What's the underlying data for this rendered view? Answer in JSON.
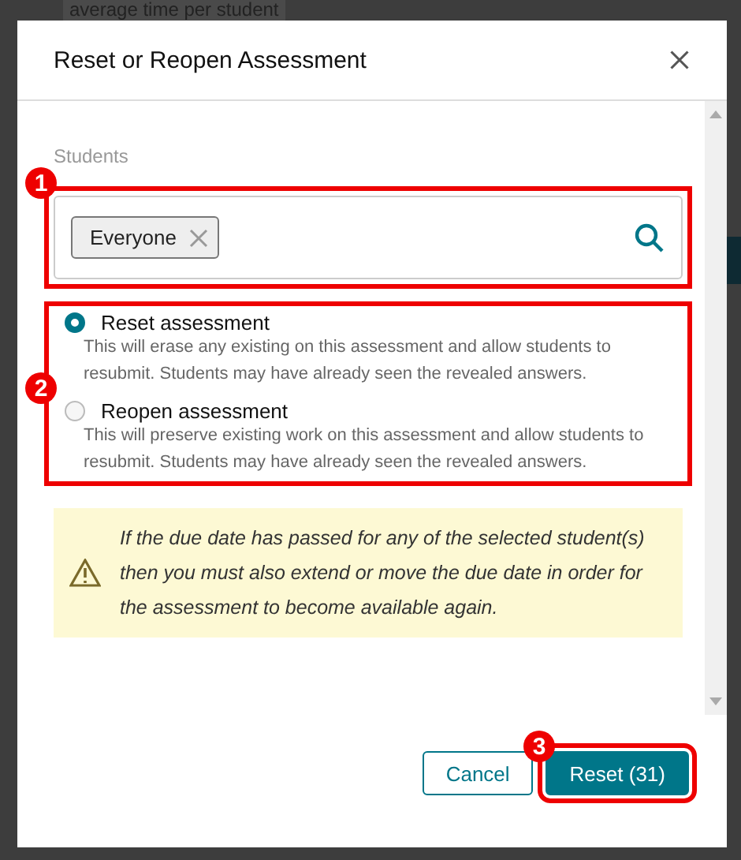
{
  "background": {
    "heading": "average time per student"
  },
  "dialog": {
    "title": "Reset or Reopen Assessment",
    "students": {
      "label": "Students",
      "tokens": [
        {
          "label": "Everyone"
        }
      ]
    },
    "options": [
      {
        "label": "Reset assessment",
        "description": "This will erase any existing on this assessment and allow students to resubmit. Students may have already seen the revealed answers.",
        "selected": true
      },
      {
        "label": "Reopen assessment",
        "description": "This will preserve existing work on this assessment and allow students to resubmit. Students may have already seen the revealed answers.",
        "selected": false
      }
    ],
    "warning": "If the due date has passed for any of the selected student(s) then you must also extend or move the due date in order for the assessment to become available again.",
    "buttons": [
      {
        "label": "Cancel",
        "kind": "secondary"
      },
      {
        "label": "Reset (31)",
        "kind": "primary"
      }
    ]
  },
  "annotations": [
    "1",
    "2",
    "3"
  ]
}
